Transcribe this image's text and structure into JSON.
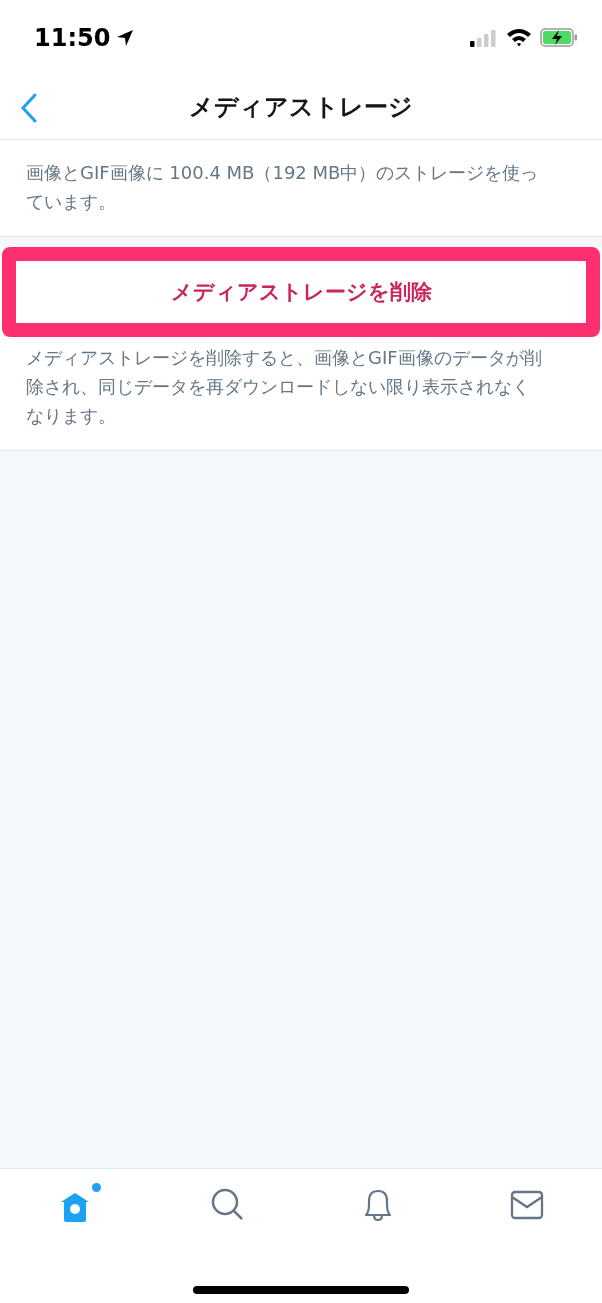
{
  "status_bar": {
    "time": "11:50"
  },
  "nav": {
    "title": "メディアストレージ"
  },
  "usage_text": "画像とGIF画像に 100.4 MB（192 MB中）のストレージを使っています。",
  "delete_button": {
    "label": "メディアストレージを削除",
    "highlighted": true
  },
  "note": "メディアストレージを削除すると、画像とGIF画像のデータが削除され、同じデータを再ダウンロードしない限り表示されなくなります。",
  "tab_bar": [
    {
      "kind": "home",
      "selected": true,
      "dot": true
    },
    {
      "kind": "search",
      "selected": false,
      "dot": false
    },
    {
      "kind": "notifications",
      "selected": false,
      "dot": false
    },
    {
      "kind": "messages",
      "selected": false,
      "dot": false
    }
  ]
}
